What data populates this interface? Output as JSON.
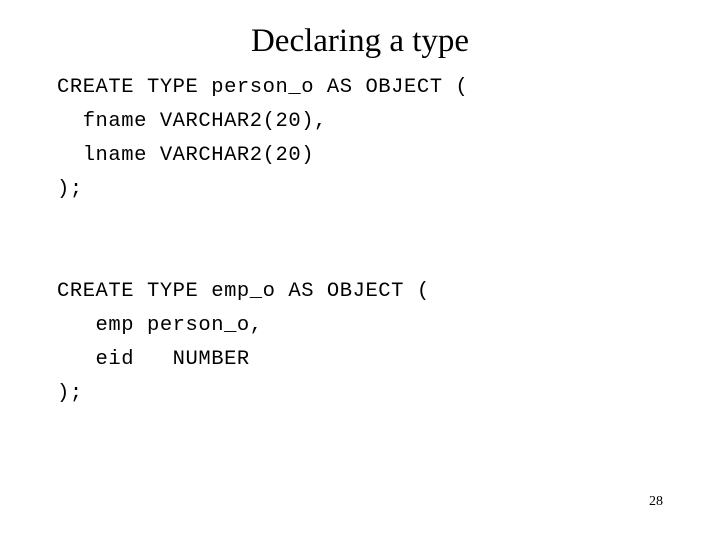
{
  "slide": {
    "title": "Declaring a type",
    "page_number": "28",
    "background_color": "#ffffff",
    "text_color": "#000000",
    "code_lines": [
      "CREATE TYPE person_o AS OBJECT (",
      "  fname VARCHAR2(20),",
      "  lname VARCHAR2(20)",
      ");",
      "",
      "",
      "CREATE TYPE emp_o AS OBJECT (",
      "   emp person_o,",
      "   eid   NUMBER",
      ");"
    ]
  }
}
